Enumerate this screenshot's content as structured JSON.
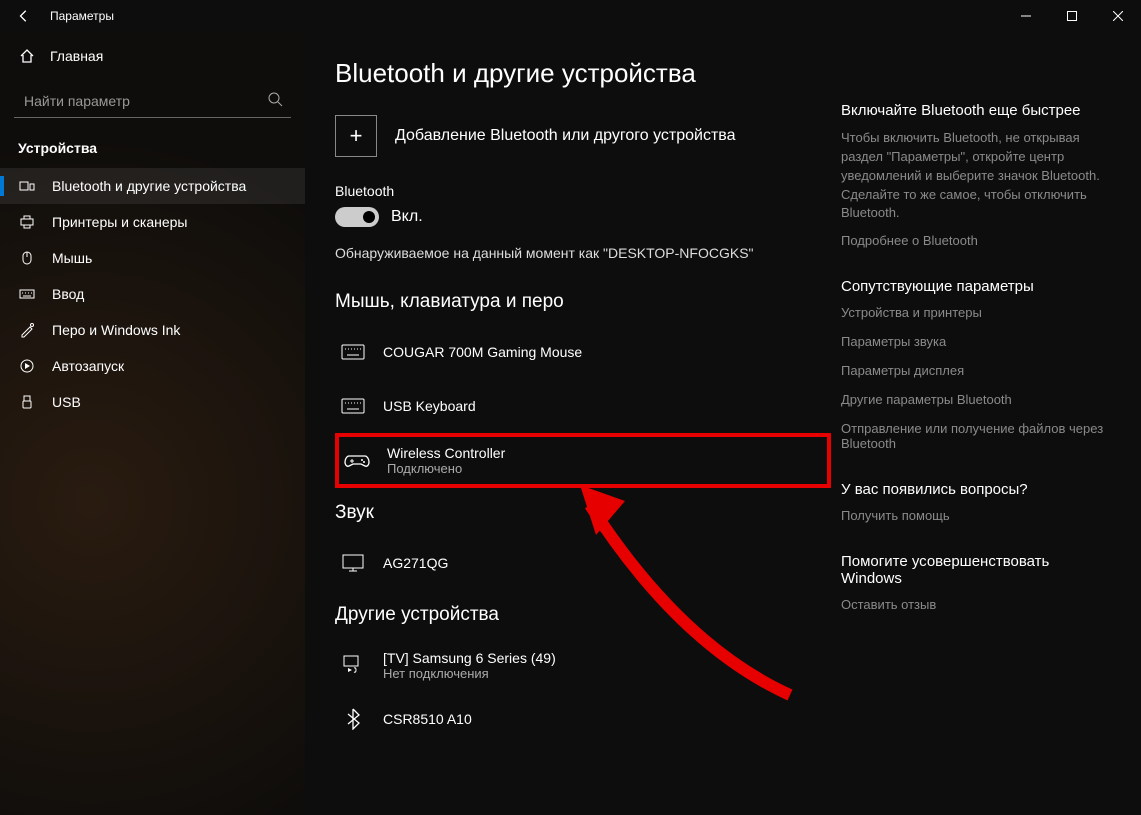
{
  "window": {
    "title": "Параметры"
  },
  "sidebar": {
    "home": "Главная",
    "search_placeholder": "Найти параметр",
    "category": "Устройства",
    "items": [
      {
        "label": "Bluetooth и другие устройства",
        "active": true
      },
      {
        "label": "Принтеры и сканеры"
      },
      {
        "label": "Мышь"
      },
      {
        "label": "Ввод"
      },
      {
        "label": "Перо и Windows Ink"
      },
      {
        "label": "Автозапуск"
      },
      {
        "label": "USB"
      }
    ]
  },
  "main": {
    "heading": "Bluetooth и другие устройства",
    "add_device": "Добавление Bluetooth или другого устройства",
    "bt_label": "Bluetooth",
    "bt_state": "Вкл.",
    "discoverable": "Обнаруживаемое на данный момент как \"DESKTOP-NFOCGKS\"",
    "sections": {
      "input": {
        "title": "Мышь, клавиатура и перо",
        "devices": [
          {
            "name": "COUGAR 700M Gaming Mouse",
            "status": "",
            "icon": "keyboard"
          },
          {
            "name": "USB Keyboard",
            "status": "",
            "icon": "keyboard"
          },
          {
            "name": "Wireless Controller",
            "status": "Подключено",
            "icon": "gamepad",
            "highlight": true
          }
        ]
      },
      "audio": {
        "title": "Звук",
        "devices": [
          {
            "name": "AG271QG",
            "status": "",
            "icon": "monitor"
          }
        ]
      },
      "other": {
        "title": "Другие устройства",
        "devices": [
          {
            "name": "[TV] Samsung 6 Series (49)",
            "status": "Нет подключения",
            "icon": "media"
          },
          {
            "name": "CSR8510 A10",
            "status": "",
            "icon": "bluetooth"
          }
        ]
      }
    }
  },
  "side": {
    "quick": {
      "title": "Включайте Bluetooth еще быстрее",
      "text": "Чтобы включить Bluetooth, не открывая раздел \"Параметры\", откройте центр уведомлений и выберите значок Bluetooth. Сделайте то же самое, чтобы отключить Bluetooth.",
      "link": "Подробнее о Bluetooth"
    },
    "related": {
      "title": "Сопутствующие параметры",
      "links": [
        "Устройства и принтеры",
        "Параметры звука",
        "Параметры дисплея",
        "Другие параметры Bluetooth",
        "Отправление или получение файлов через Bluetooth"
      ]
    },
    "questions": {
      "title": "У вас появились вопросы?",
      "link": "Получить помощь"
    },
    "improve": {
      "title": "Помогите усовершенствовать Windows",
      "link": "Оставить отзыв"
    }
  }
}
